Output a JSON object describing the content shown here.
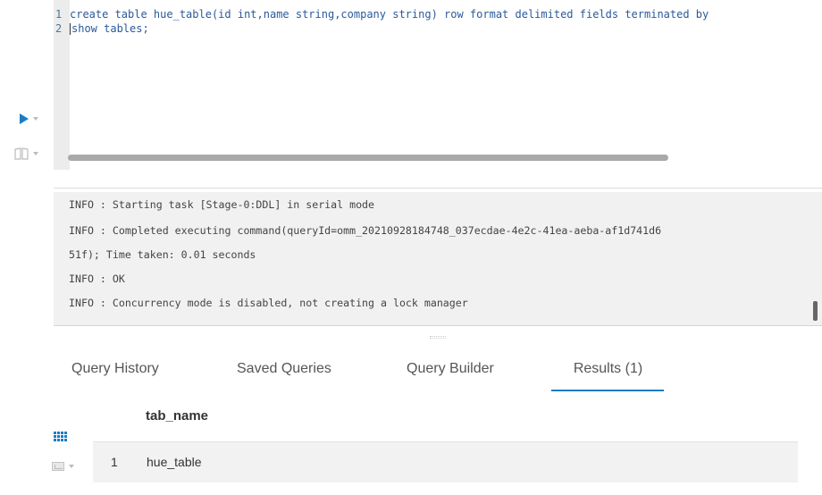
{
  "editor": {
    "line1_number": "1",
    "line1_text": "create table hue_table(id int,name string,company string) row format delimited fields terminated by",
    "line2_number": "2",
    "line2_text": "show tables;"
  },
  "controls": {
    "run_icon": "play-icon",
    "book_icon": "book-icon"
  },
  "log": {
    "partial_line": "INFO  : Starting task [Stage-0:DDL] in serial mode",
    "line1": "INFO  : Completed executing command(queryId=omm_20210928184748_037ecdae-4e2c-41ea-aeba-af1d741d6",
    "line2": "51f); Time taken: 0.01 seconds",
    "line3": "INFO  : OK",
    "line4": "INFO  : Concurrency mode is disabled, not creating a lock manager"
  },
  "tabs": [
    {
      "label": "Query History"
    },
    {
      "label": "Saved Queries"
    },
    {
      "label": "Query Builder"
    },
    {
      "label": "Results (1)",
      "active": true
    }
  ],
  "results": {
    "columns": [
      "tab_name"
    ],
    "rows": [
      {
        "index": "1",
        "tab_name": "hue_table"
      }
    ],
    "grid_icon": "grid-icon",
    "chart_icon": "chart-icon"
  },
  "colors": {
    "accent": "#1a7cc4",
    "code_text": "#2a5a9a",
    "log_background": "#f1f1f1"
  }
}
